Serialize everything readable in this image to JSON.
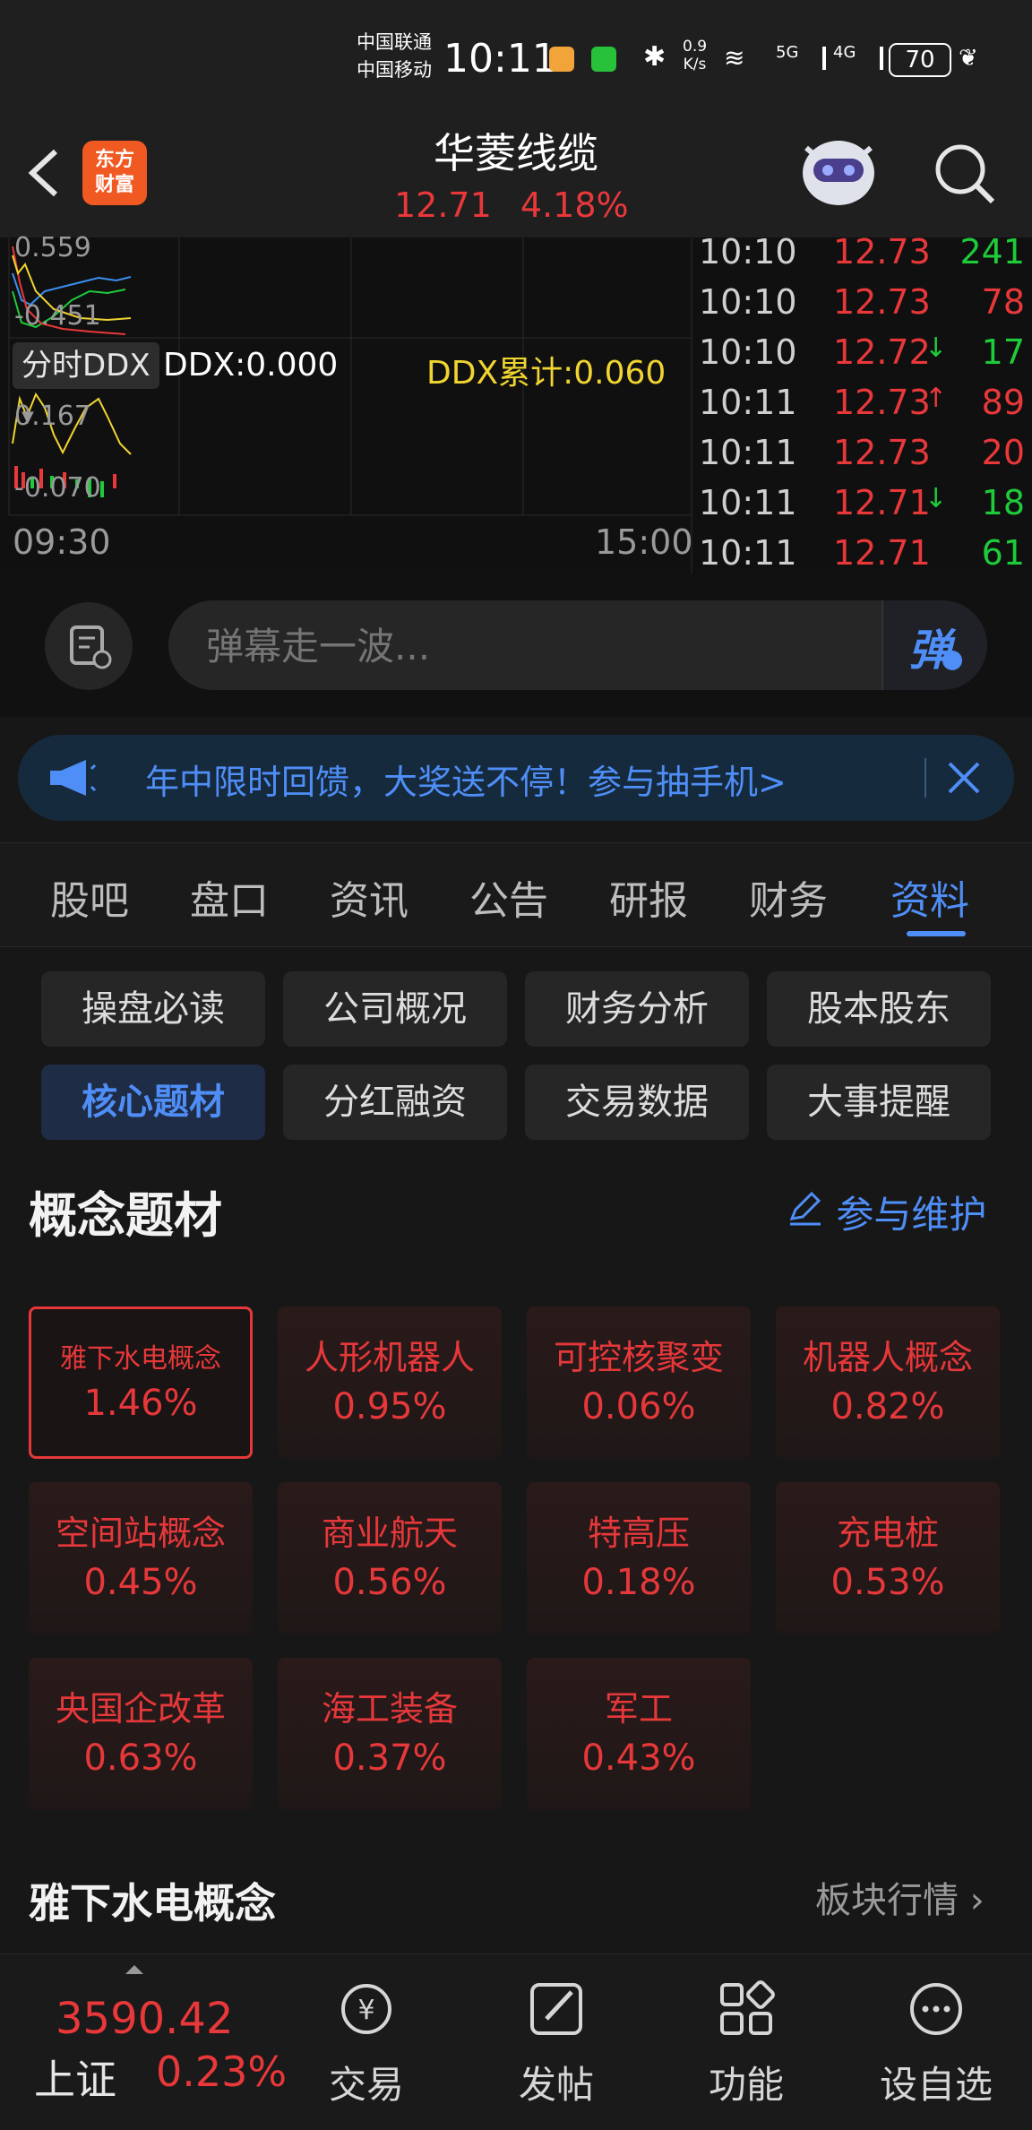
{
  "status": {
    "carrier1": "中国联通",
    "carrier2": "中国移动",
    "time": "10:11",
    "net_speed_value": "0.9",
    "net_speed_unit": "K/s",
    "net_5g": "5G",
    "net_4g": "4G",
    "battery": "70"
  },
  "header": {
    "logo_line1": "东方",
    "logo_line2": "财富",
    "title": "华菱线缆",
    "price": "12.71",
    "change": "4.18%"
  },
  "chart": {
    "upper_top_label": "0.559",
    "upper_bottom_label": "-0.451",
    "selector": "分时DDX",
    "ddx_label": "DDX:0.000",
    "ddx_cum_label": "DDX累计:0.060",
    "lower_top_label": "0.167",
    "lower_bottom_label": "-0.070",
    "time_start": "09:30",
    "time_end": "15:00"
  },
  "ticks": [
    {
      "time": "10:10",
      "price": "12.73",
      "arrow": "",
      "vol": "241",
      "vol_color": "green"
    },
    {
      "time": "10:10",
      "price": "12.73",
      "arrow": "",
      "vol": "78",
      "vol_color": "red"
    },
    {
      "time": "10:10",
      "price": "12.72",
      "arrow": "↓",
      "vol": "17",
      "vol_color": "green"
    },
    {
      "time": "10:11",
      "price": "12.73",
      "arrow": "↑",
      "vol": "89",
      "vol_color": "red"
    },
    {
      "time": "10:11",
      "price": "12.73",
      "arrow": "",
      "vol": "20",
      "vol_color": "red"
    },
    {
      "time": "10:11",
      "price": "12.71",
      "arrow": "↓",
      "vol": "18",
      "vol_color": "green"
    },
    {
      "time": "10:11",
      "price": "12.71",
      "arrow": "",
      "vol": "61",
      "vol_color": "green"
    }
  ],
  "barrage": {
    "placeholder": "弹幕走一波...",
    "send_label": "弹"
  },
  "banner": {
    "text": "年中限时回馈，大奖送不停！参与抽手机>"
  },
  "tabs": [
    "股吧",
    "盘口",
    "资讯",
    "公告",
    "研报",
    "财务",
    "资料"
  ],
  "active_tab": "资料",
  "subtabs": [
    "操盘必读",
    "公司概况",
    "财务分析",
    "股本股东",
    "核心题材",
    "分红融资",
    "交易数据",
    "大事提醒"
  ],
  "active_subtab": "核心题材",
  "concepts": {
    "title": "概念题材",
    "maintain": "参与维护",
    "items": [
      {
        "name": "雅下水电概念",
        "pct": "1.46%"
      },
      {
        "name": "人形机器人",
        "pct": "0.95%"
      },
      {
        "name": "可控核聚变",
        "pct": "0.06%"
      },
      {
        "name": "机器人概念",
        "pct": "0.82%"
      },
      {
        "name": "空间站概念",
        "pct": "0.45%"
      },
      {
        "name": "商业航天",
        "pct": "0.56%"
      },
      {
        "name": "特高压",
        "pct": "0.18%"
      },
      {
        "name": "充电桩",
        "pct": "0.53%"
      },
      {
        "name": "央国企改革",
        "pct": "0.63%"
      },
      {
        "name": "海工装备",
        "pct": "0.37%"
      },
      {
        "name": "军工",
        "pct": "0.43%"
      }
    ]
  },
  "section": {
    "title": "雅下水电概念",
    "link": "板块行情"
  },
  "bottom": {
    "index_value": "3590.42",
    "index_name": "上证",
    "index_change": "0.23%",
    "nav": [
      "交易",
      "发帖",
      "功能",
      "设自选"
    ]
  },
  "colors": {
    "up": "#e9383a",
    "down": "#1ecb3a",
    "accent": "#4f8ef7",
    "ddx_cum": "#f0d431"
  }
}
